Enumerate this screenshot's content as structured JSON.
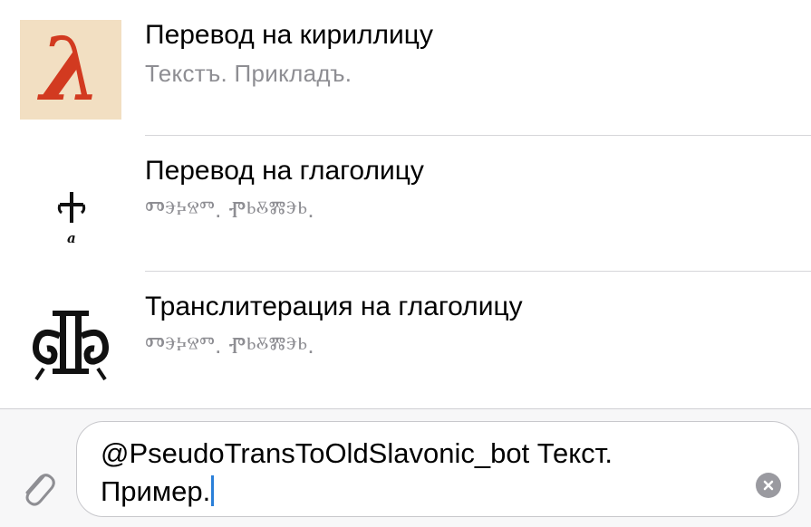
{
  "results": [
    {
      "icon": "cyrillic-letter-a-icon",
      "icon_glyph": "λ",
      "title": "Перевод на кириллицу",
      "subtitle": "Текстъ. Прикладъ."
    },
    {
      "icon": "glagolitic-letter-a-icon",
      "icon_caption": "a",
      "title": "Перевод на глаголицу",
      "subtitle": "Ⱅⰵⰽⱄⱅ. Ⱂⱃⰻⰿⰵⱃ."
    },
    {
      "icon": "glagolitic-ornament-icon",
      "title": "Транслитерация на глаголицу",
      "subtitle": "Ⱅⰵⰽⱄⱅ. Ⱂⱃⰻⰿⰵⱃ."
    }
  ],
  "composer": {
    "input_line_1": "@PseudoTransToOldSlavonic_bot Текст.",
    "input_line_2": "Пример.",
    "attach_icon": "paperclip-icon",
    "clear_icon": "clear-text-icon",
    "caret_color": "#2a7fd9"
  }
}
